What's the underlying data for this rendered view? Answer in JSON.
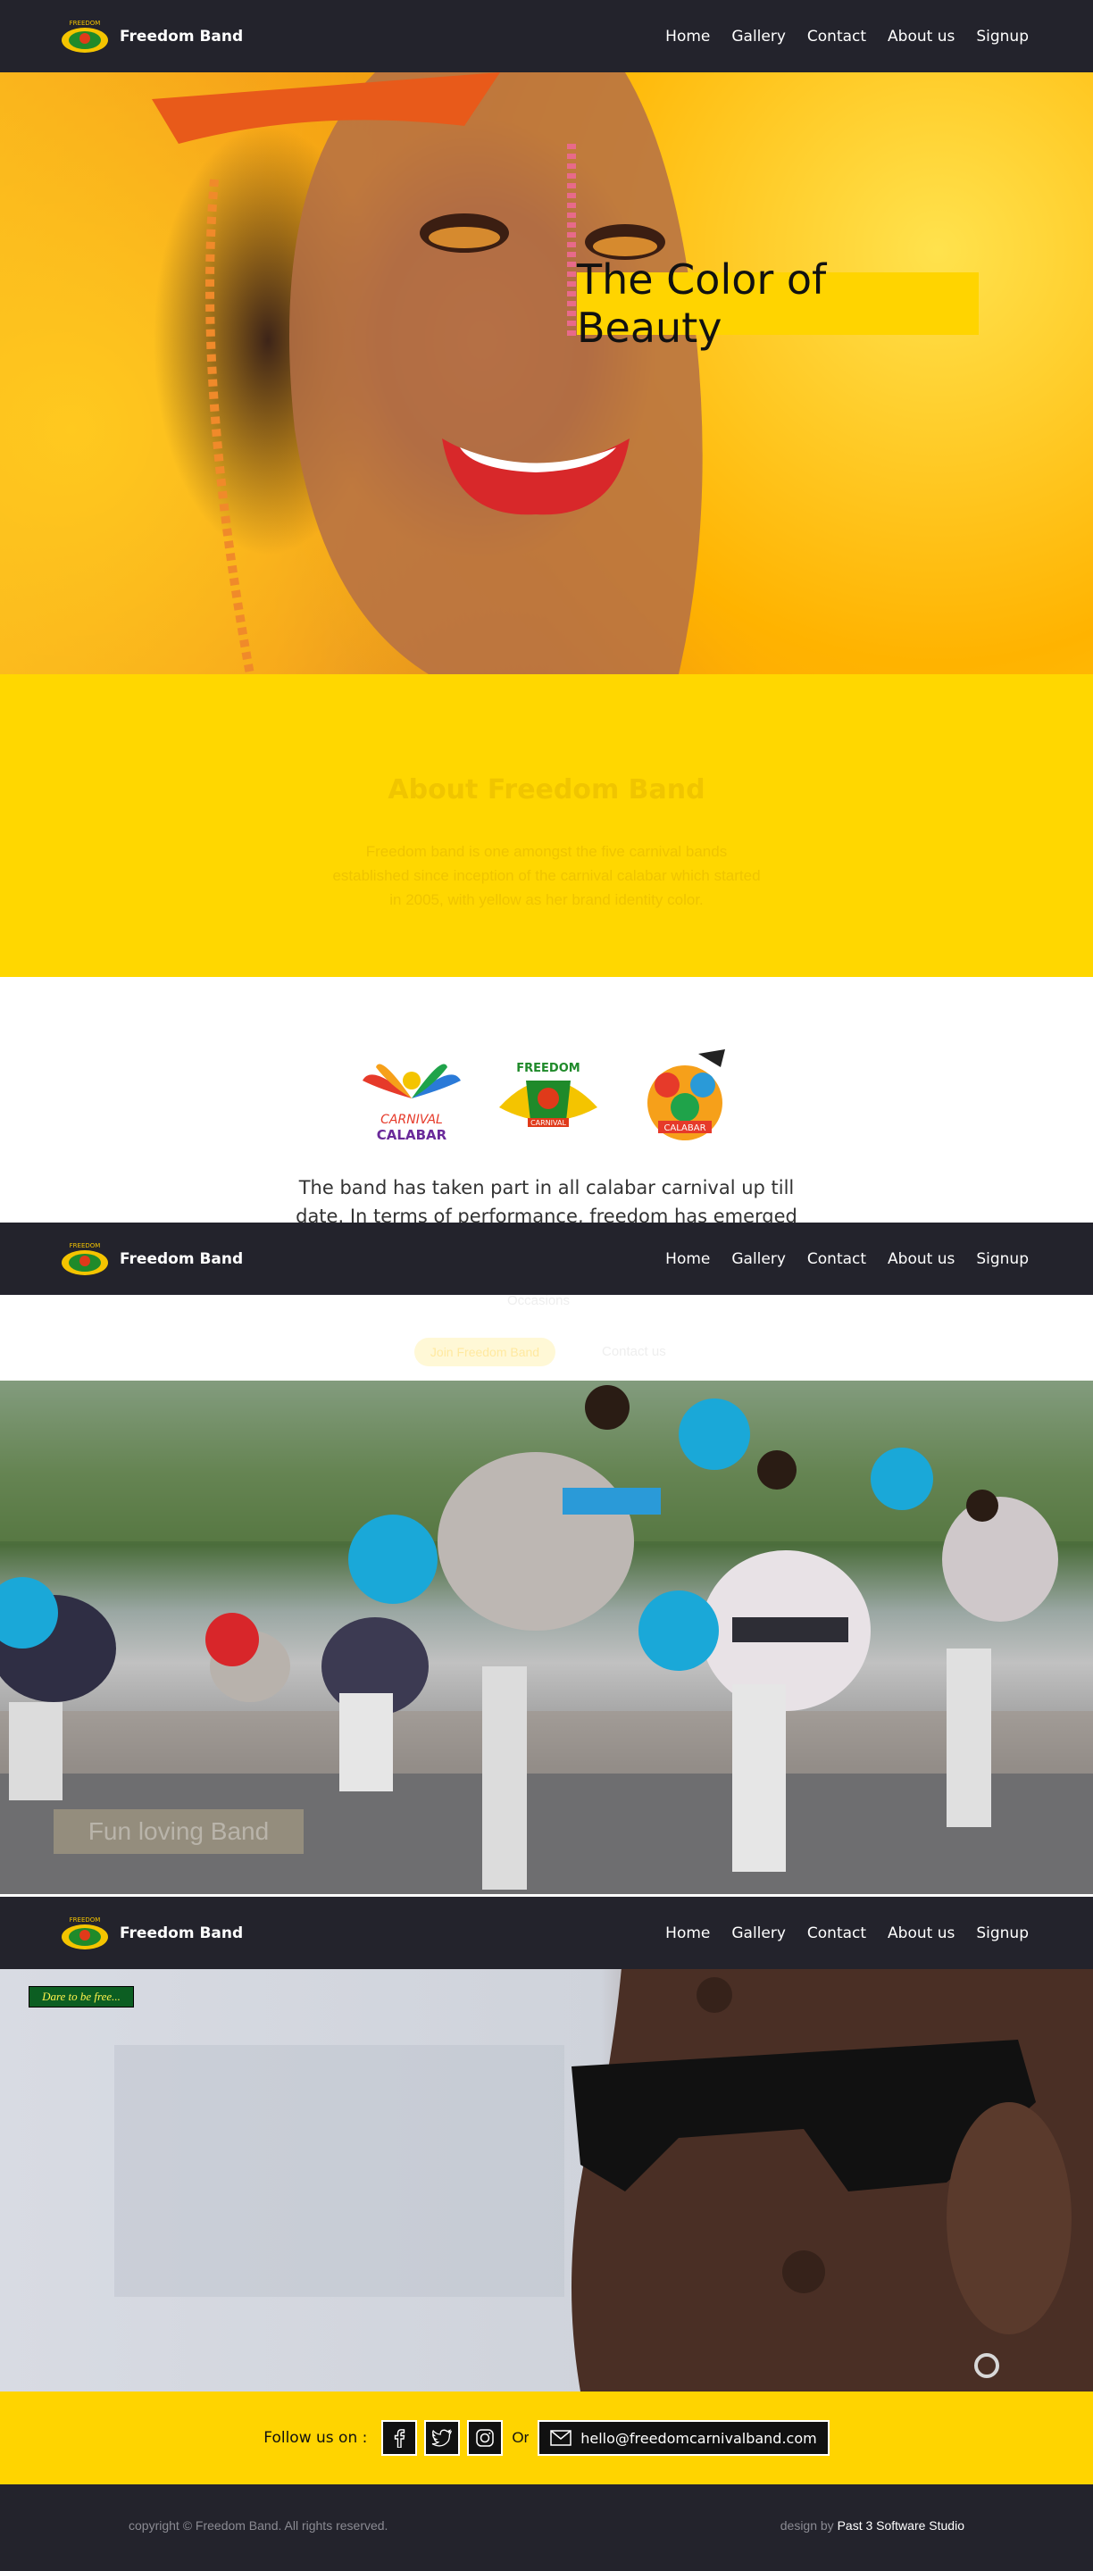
{
  "brand": {
    "name": "Freedom Band"
  },
  "nav": {
    "items": [
      "Home",
      "Gallery",
      "Contact",
      "About us",
      "Signup"
    ]
  },
  "hero": {
    "title": "The Color of Beauty"
  },
  "about": {
    "heading": "About Freedom Band",
    "text": "Freedom band is one amongst the five carnival bands established since inception of the carnival calabar which started in 2005, with yellow as her brand identity color."
  },
  "partners": {
    "text": "The band has taken part in all calabar carnival up till date. In terms of performance, freedom has emerged victorious as",
    "faded_word": "Occasions",
    "button_label": "Join Freedom Band",
    "contact_label": "Contact us"
  },
  "dancers": {
    "caption": "Fun loving Band"
  },
  "closeup": {
    "tagline": "Dare to be free..."
  },
  "follow": {
    "label": "Follow us on :",
    "or": "Or",
    "email": "hello@freedomcarnivalband.com",
    "icons": [
      "facebook-icon",
      "twitter-icon",
      "instagram-icon",
      "mail-icon"
    ]
  },
  "footer": {
    "copyright": "copyright © Freedom Band. All rights reserved.",
    "credit_prefix": "design by",
    "credit_name": "Past 3 Software Studio"
  },
  "colors": {
    "brand_yellow": "#ffd400",
    "nav_dark": "#23232c"
  }
}
